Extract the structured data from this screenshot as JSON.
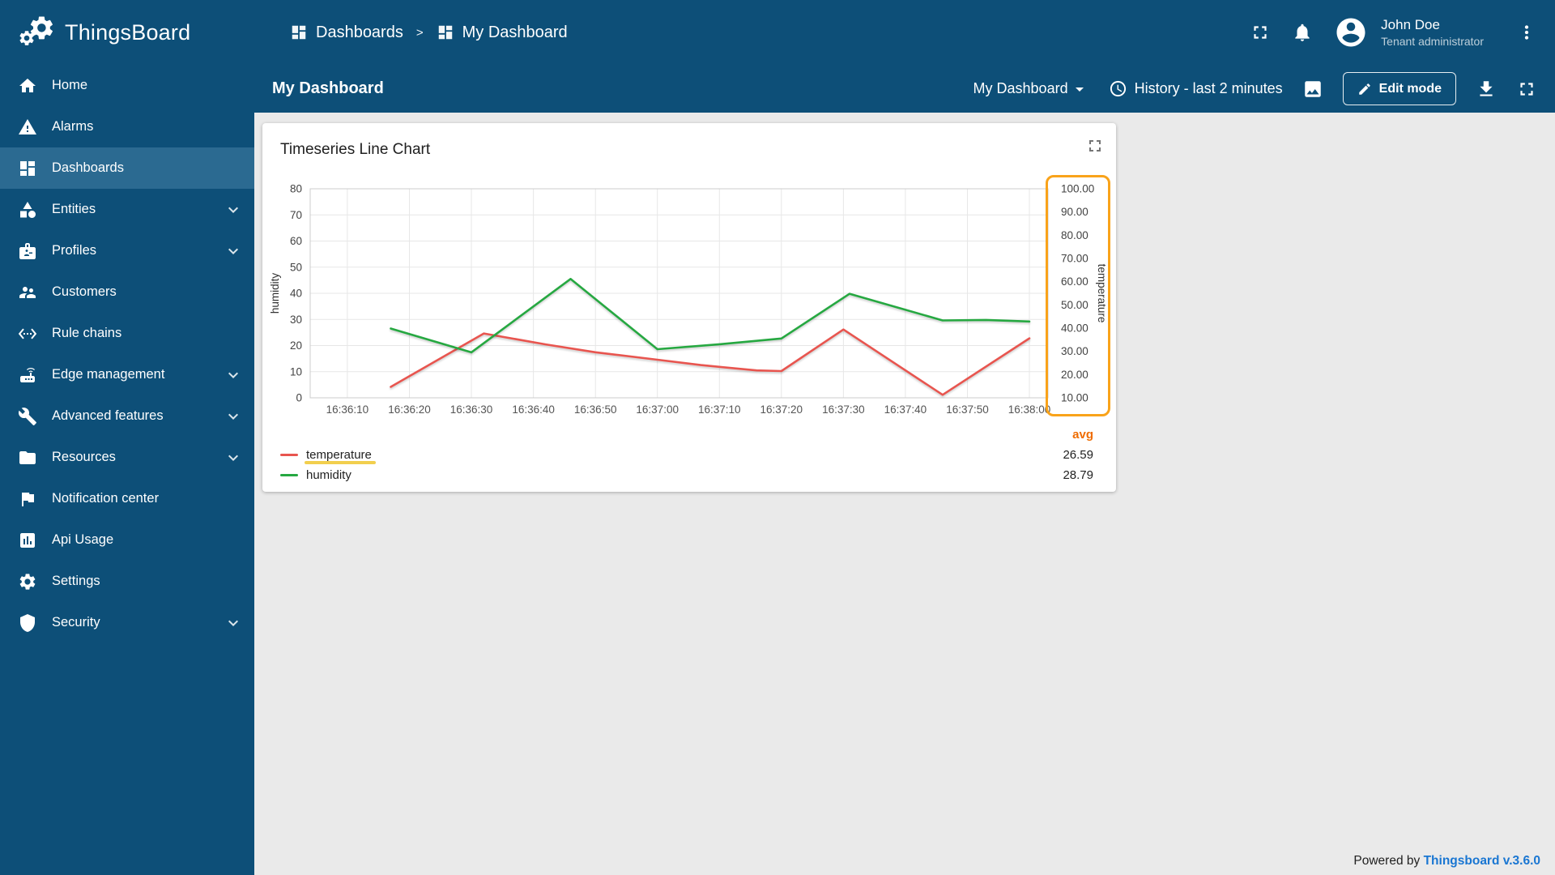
{
  "app": {
    "title": "ThingsBoard"
  },
  "theme": {
    "primary": "#0d4f78",
    "sidebar_selected": "#2b6a91",
    "content_bg": "#eaeaea",
    "highlight_orange": "#f9a31a",
    "highlight_yellow": "#f2cf4e",
    "avg_header_color": "#ef6c00",
    "link_blue": "#1976d2"
  },
  "header": {
    "breadcrumb": {
      "separator": ">",
      "items": [
        {
          "label": "Dashboards",
          "icon": "dashboard"
        },
        {
          "label": "My Dashboard",
          "icon": "dashboard"
        }
      ]
    },
    "action_icons": [
      "fullscreen",
      "notifications-bell",
      "account-avatar",
      "more-menu"
    ],
    "user": {
      "name": "John Doe",
      "role": "Tenant administrator"
    }
  },
  "toolbar": {
    "title": "My Dashboard",
    "dashboard_selector": "My Dashboard",
    "history_label": "History - last 2 minutes",
    "edit_button": "Edit mode",
    "action_icons": [
      "dashboard-select-caret",
      "history-clock",
      "background-image",
      "edit-pencil",
      "download",
      "fullscreen"
    ]
  },
  "sidebar": {
    "items": [
      {
        "label": "Home",
        "icon": "home",
        "selected": false,
        "expandable": false
      },
      {
        "label": "Alarms",
        "icon": "warning",
        "selected": false,
        "expandable": false
      },
      {
        "label": "Dashboards",
        "icon": "dashboard",
        "selected": true,
        "expandable": false
      },
      {
        "label": "Entities",
        "icon": "category",
        "selected": false,
        "expandable": true
      },
      {
        "label": "Profiles",
        "icon": "badge",
        "selected": false,
        "expandable": true
      },
      {
        "label": "Customers",
        "icon": "people",
        "selected": false,
        "expandable": false
      },
      {
        "label": "Rule chains",
        "icon": "code",
        "selected": false,
        "expandable": false
      },
      {
        "label": "Edge management",
        "icon": "router",
        "selected": false,
        "expandable": true
      },
      {
        "label": "Advanced features",
        "icon": "wrench",
        "selected": false,
        "expandable": true
      },
      {
        "label": "Resources",
        "icon": "folder",
        "selected": false,
        "expandable": true
      },
      {
        "label": "Notification center",
        "icon": "flag",
        "selected": false,
        "expandable": false
      },
      {
        "label": "Api Usage",
        "icon": "insert-chart",
        "selected": false,
        "expandable": false
      },
      {
        "label": "Settings",
        "icon": "gear",
        "selected": false,
        "expandable": false
      },
      {
        "label": "Security",
        "icon": "shield",
        "selected": false,
        "expandable": true
      }
    ]
  },
  "widget": {
    "title": "Timeseries Line Chart"
  },
  "chart_data": {
    "type": "line",
    "title": "Timeseries Line Chart",
    "x_ticks": [
      "16:36:10",
      "16:36:20",
      "16:36:30",
      "16:36:40",
      "16:36:50",
      "16:37:00",
      "16:37:10",
      "16:37:20",
      "16:37:30",
      "16:37:40",
      "16:37:50",
      "16:38:00"
    ],
    "x_tick_seconds": [
      0,
      10,
      20,
      30,
      40,
      50,
      60,
      70,
      80,
      90,
      100,
      110
    ],
    "x_range_seconds": [
      -6,
      113
    ],
    "grid": true,
    "left_axis": {
      "label": "humidity",
      "min": 0,
      "max": 80,
      "tick_step": 10
    },
    "right_axis": {
      "label": "temperature",
      "min": 10,
      "max": 100,
      "tick_step": 10,
      "tick_format": "2dp",
      "highlighted": true
    },
    "legend": {
      "position": "bottom",
      "avg_label": "avg"
    },
    "series": [
      {
        "name": "temperature",
        "axis": "right",
        "color": "#e8554f",
        "avg": 26.59,
        "highlighted": true,
        "points": [
          [
            7,
            14.7
          ],
          [
            22,
            37.7
          ],
          [
            32,
            33.0
          ],
          [
            40,
            29.6
          ],
          [
            50,
            26.4
          ],
          [
            57,
            24.1
          ],
          [
            66,
            21.8
          ],
          [
            70,
            21.5
          ],
          [
            80,
            39.4
          ],
          [
            96,
            11.3
          ],
          [
            110,
            35.6
          ]
        ]
      },
      {
        "name": "humidity",
        "axis": "left",
        "color": "#26a841",
        "avg": 28.79,
        "highlighted": false,
        "points": [
          [
            7,
            26.5
          ],
          [
            20,
            17.4
          ],
          [
            36,
            45.5
          ],
          [
            50,
            18.6
          ],
          [
            60,
            20.5
          ],
          [
            70,
            22.7
          ],
          [
            81,
            39.8
          ],
          [
            96,
            29.6
          ],
          [
            103,
            29.8
          ],
          [
            110,
            29.2
          ]
        ]
      }
    ]
  },
  "footer": {
    "powered_by": "Powered by",
    "version_link": "Thingsboard v.3.6.0"
  }
}
